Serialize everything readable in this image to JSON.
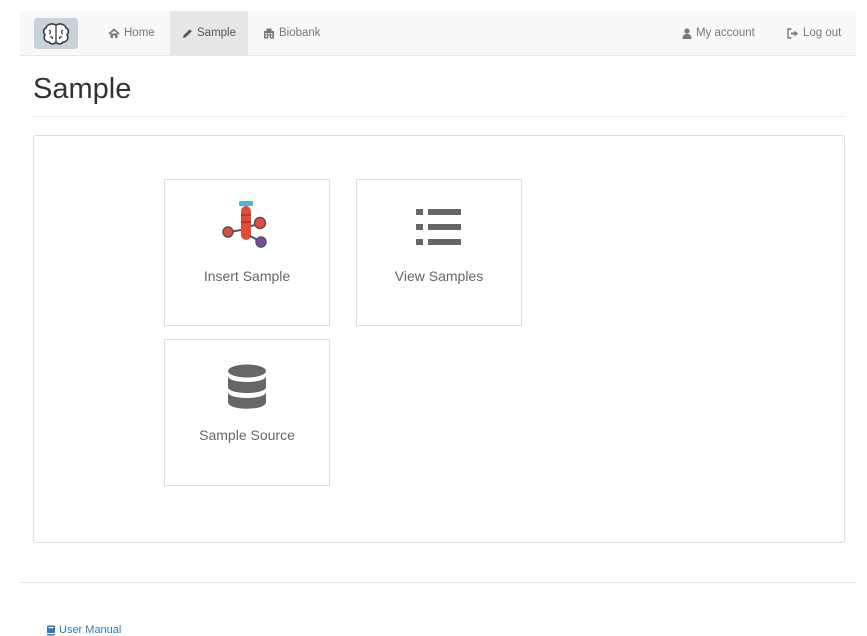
{
  "navbar": {
    "brand_icon": "brain-icon",
    "items": [
      {
        "label": "Home",
        "icon": "home-icon",
        "active": false
      },
      {
        "label": "Sample",
        "icon": "pencil-icon",
        "active": true
      },
      {
        "label": "Biobank",
        "icon": "building-icon",
        "active": false
      }
    ],
    "right_items": [
      {
        "label": "My account",
        "icon": "user-icon"
      },
      {
        "label": "Log out",
        "icon": "log-out-icon"
      }
    ]
  },
  "page": {
    "title": "Sample"
  },
  "tiles": [
    {
      "label": "Insert Sample",
      "icon": "test-tube-icon"
    },
    {
      "label": "View Samples",
      "icon": "list-icon"
    },
    {
      "label": "Sample Source",
      "icon": "database-icon"
    }
  ],
  "footer": {
    "link_label": "User Manual",
    "link_icon": "book-icon"
  },
  "colors": {
    "navbar_bg": "#f8f8f8",
    "active_nav_bg": "#e7e7e7",
    "link_blue": "#337ab7",
    "tube_red": "#e04b3a",
    "tube_cap": "#4db6d8",
    "node_purple": "#7b4a9e",
    "icon_gray": "#666666"
  }
}
